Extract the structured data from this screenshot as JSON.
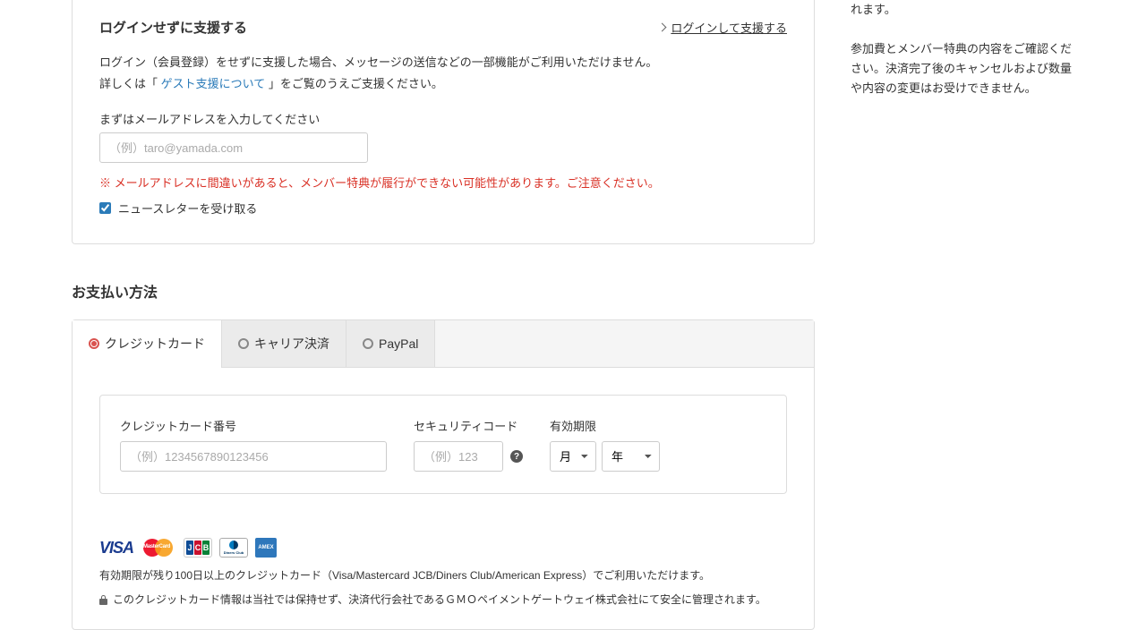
{
  "side": {
    "line1": "れます。",
    "line2": "参加費とメンバー特典の内容をご確認ください。決済完了後のキャンセルおよび数量や内容の変更はお受けできません。"
  },
  "login": {
    "title": "ログインせずに支援する",
    "login_link": "ログインして支援する",
    "desc1": "ログイン（会員登録）をせずに支援した場合、メッセージの送信などの一部機能がご利用いただけません。",
    "desc2_pre": "詳しくは「 ",
    "guest_link": "ゲスト支援について",
    "desc2_post": " 」をご覧のうえご支援ください。",
    "email_label": "まずはメールアドレスを入力してください",
    "email_placeholder": "（例）taro@yamada.com",
    "warning": "※ メールアドレスに間違いがあると、メンバー特典が履行ができない可能性があります。ご注意ください。",
    "newsletter_label": "ニュースレターを受け取る"
  },
  "payment": {
    "title": "お支払い方法",
    "tabs": {
      "credit": "クレジットカード",
      "carrier": "キャリア決済",
      "paypal": "PayPal"
    },
    "card": {
      "number_label": "クレジットカード番号",
      "number_placeholder": "（例）1234567890123456",
      "security_label": "セキュリティコード",
      "security_placeholder": "（例）123",
      "expiry_label": "有効期限",
      "month": "月",
      "year": "年"
    },
    "note": "有効期限が残り100日以上のクレジットカード（Visa/Mastercard JCB/Diners Club/American Express）でご利用いただけます。",
    "security_note": "このクレジットカード情報は当社では保持せず、決済代行会社であるＧＭＯペイメントゲートウェイ株式会社にて安全に管理されます。"
  }
}
